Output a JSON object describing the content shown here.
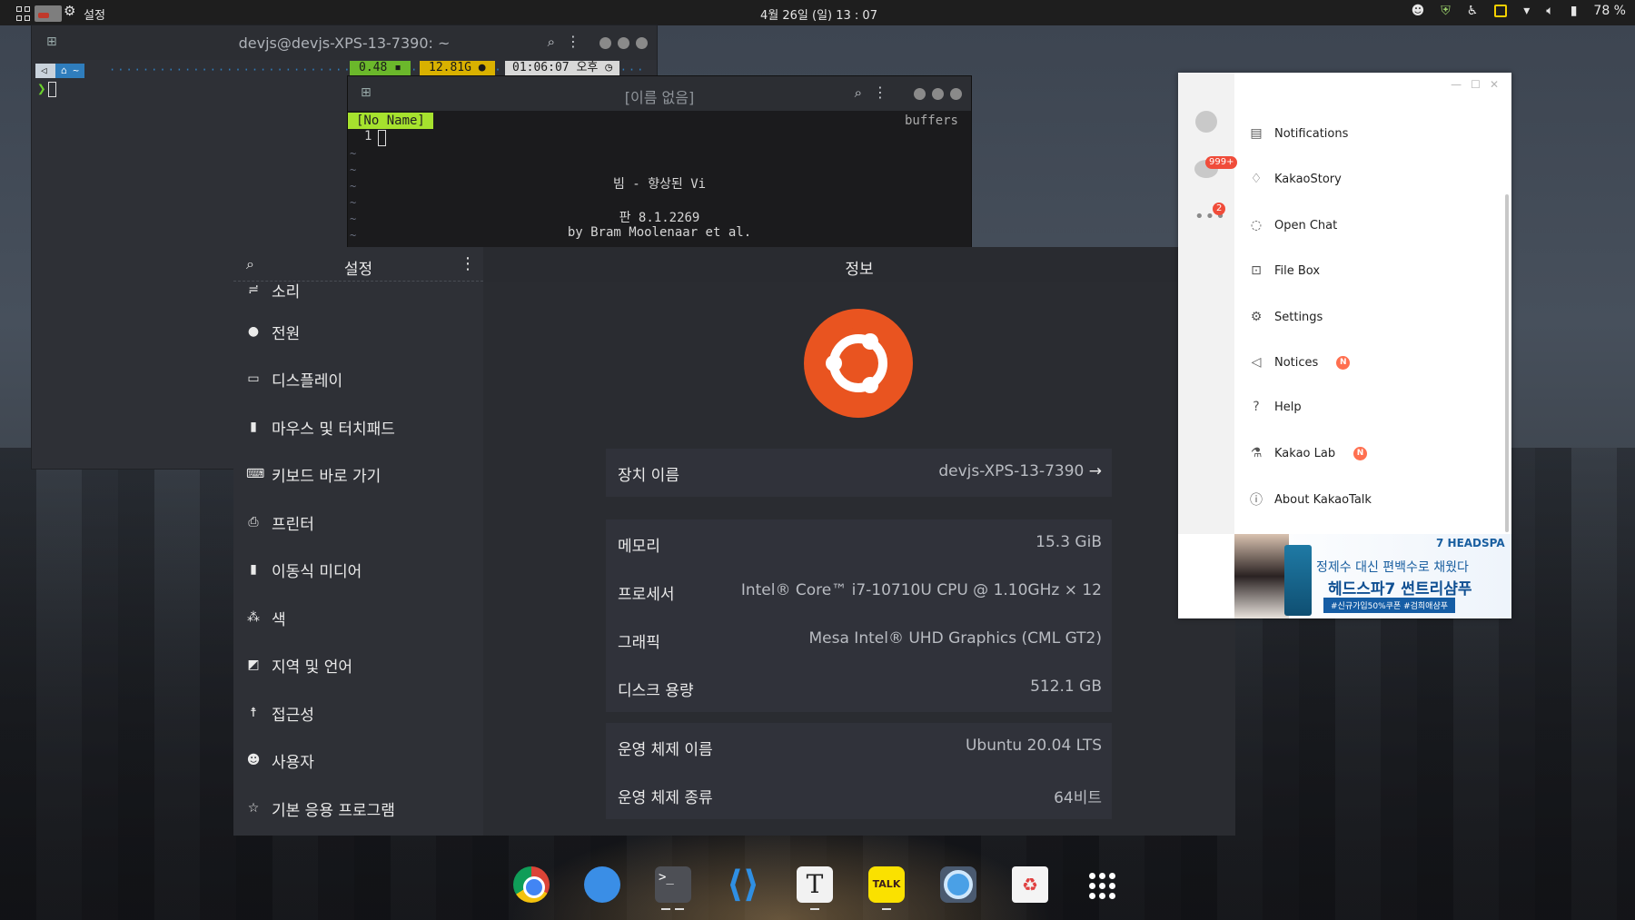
{
  "topbar": {
    "app_name": "설정",
    "clock": "4월 26일 (일)  13 : 07",
    "battery": "78 %"
  },
  "terminal": {
    "title": "devjs@devjs-XPS-13-7390: ~",
    "prompt_home": "~",
    "status_load": "0.48",
    "status_mem": "12.81G",
    "status_time": "01:06:07 오후"
  },
  "vim": {
    "title": "[이름 없음]",
    "tab": "[No Name]",
    "buffers": "buffers",
    "line_no": "1",
    "intro_title": "빔 - 향상된 Vi",
    "intro_version": "판 8.1.2269",
    "intro_author": "by Bram Moolenaar et al."
  },
  "settings": {
    "sidebar_title": "설정",
    "main_title": "정보",
    "sidebar_items": [
      {
        "label": "소리",
        "icon": "sound-icon"
      },
      {
        "label": "전원",
        "icon": "power-icon"
      },
      {
        "label": "디스플레이",
        "icon": "display-icon"
      },
      {
        "label": "마우스 및 터치패드",
        "icon": "mouse-icon"
      },
      {
        "label": "키보드 바로 가기",
        "icon": "keyboard-icon"
      },
      {
        "label": "프린터",
        "icon": "printer-icon"
      },
      {
        "label": "이동식 미디어",
        "icon": "usb-icon"
      },
      {
        "label": "색",
        "icon": "color-icon"
      },
      {
        "label": "지역 및 언어",
        "icon": "language-icon"
      },
      {
        "label": "접근성",
        "icon": "accessibility-icon"
      },
      {
        "label": "사용자",
        "icon": "users-icon"
      },
      {
        "label": "기본 응용 프로그램",
        "icon": "star-icon"
      }
    ],
    "device_name_label": "장치 이름",
    "device_name_value": "devjs-XPS-13-7390",
    "memory_label": "메모리",
    "memory_value": "15.3 GiB",
    "processor_label": "프로세서",
    "processor_value": "Intel® Core™ i7-10710U CPU @ 1.10GHz × 12",
    "graphics_label": "그래픽",
    "graphics_value": "Mesa Intel® UHD Graphics (CML GT2)",
    "disk_label": "디스크 용량",
    "disk_value": "512.1 GB",
    "os_name_label": "운영 체제 이름",
    "os_name_value": "Ubuntu 20.04 LTS",
    "os_type_label": "운영 체제 종류",
    "os_type_value": "64비트",
    "accent_color": "#e95420"
  },
  "kakao": {
    "chat_badge": "999+",
    "more_badge": "2",
    "menu": [
      {
        "label": "Notifications",
        "icon": "notification-icon",
        "new": false
      },
      {
        "label": "KakaoStory",
        "icon": "kakaostory-icon",
        "new": false
      },
      {
        "label": "Open Chat",
        "icon": "openchat-icon",
        "new": false
      },
      {
        "label": "File Box",
        "icon": "filebox-icon",
        "new": false
      },
      {
        "label": "Settings",
        "icon": "settings-icon",
        "new": false
      },
      {
        "label": "Notices",
        "icon": "megaphone-icon",
        "new": true
      },
      {
        "label": "Help",
        "icon": "help-icon",
        "new": false
      },
      {
        "label": "Kakao Lab",
        "icon": "flask-icon",
        "new": true
      },
      {
        "label": "About KakaoTalk",
        "icon": "info-icon",
        "new": false
      }
    ],
    "new_badge": "N",
    "ad_brand": "7 HEADSPA",
    "ad_line1": "정제수 대신 편백수로 채웠다",
    "ad_line2": "헤드스파7 썬트리샴푸",
    "ad_line3": "#신규가입50%쿠폰 #검희애샴푸"
  },
  "dock": {
    "items": [
      "chrome-icon",
      "files-icon",
      "terminal-icon",
      "vscode-icon",
      "typora-icon",
      "kakaotalk-icon",
      "active-app-icon",
      "trash-icon",
      "app-grid-icon"
    ],
    "kakao_label": "TALK",
    "typora_label": "T"
  }
}
